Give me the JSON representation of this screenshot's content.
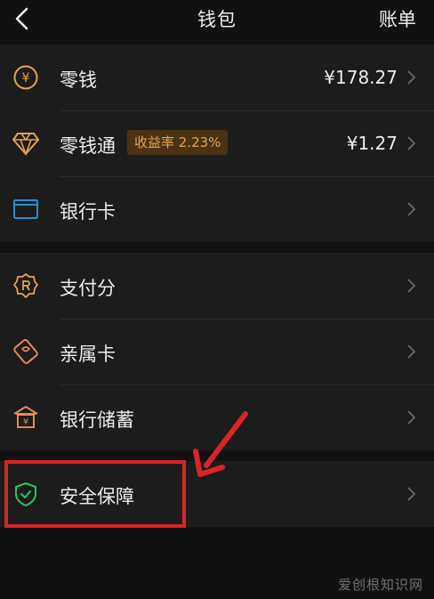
{
  "header": {
    "title": "钱包",
    "action": "账单"
  },
  "sections": [
    {
      "items": [
        {
          "label": "零钱",
          "value": "¥178.27",
          "icon": "yen-coin-icon"
        },
        {
          "label": "零钱通",
          "badge": "收益率 2.23%",
          "value": "¥1.27",
          "icon": "diamond-icon"
        },
        {
          "label": "银行卡",
          "icon": "bank-card-icon"
        }
      ]
    },
    {
      "items": [
        {
          "label": "支付分",
          "icon": "score-badge-icon"
        },
        {
          "label": "亲属卡",
          "icon": "family-card-icon"
        },
        {
          "label": "银行储蓄",
          "icon": "bank-building-icon"
        }
      ]
    },
    {
      "items": [
        {
          "label": "安全保障",
          "icon": "shield-check-icon"
        }
      ]
    }
  ],
  "annotation": {
    "color": "#d92427"
  },
  "watermark": "爱创根知识网",
  "colors": {
    "background": "#111111",
    "section": "#1c1c1c",
    "accent_gold": "#e9a34a",
    "card_blue": "#2a8fd6",
    "shield_green": "#2fc163"
  }
}
